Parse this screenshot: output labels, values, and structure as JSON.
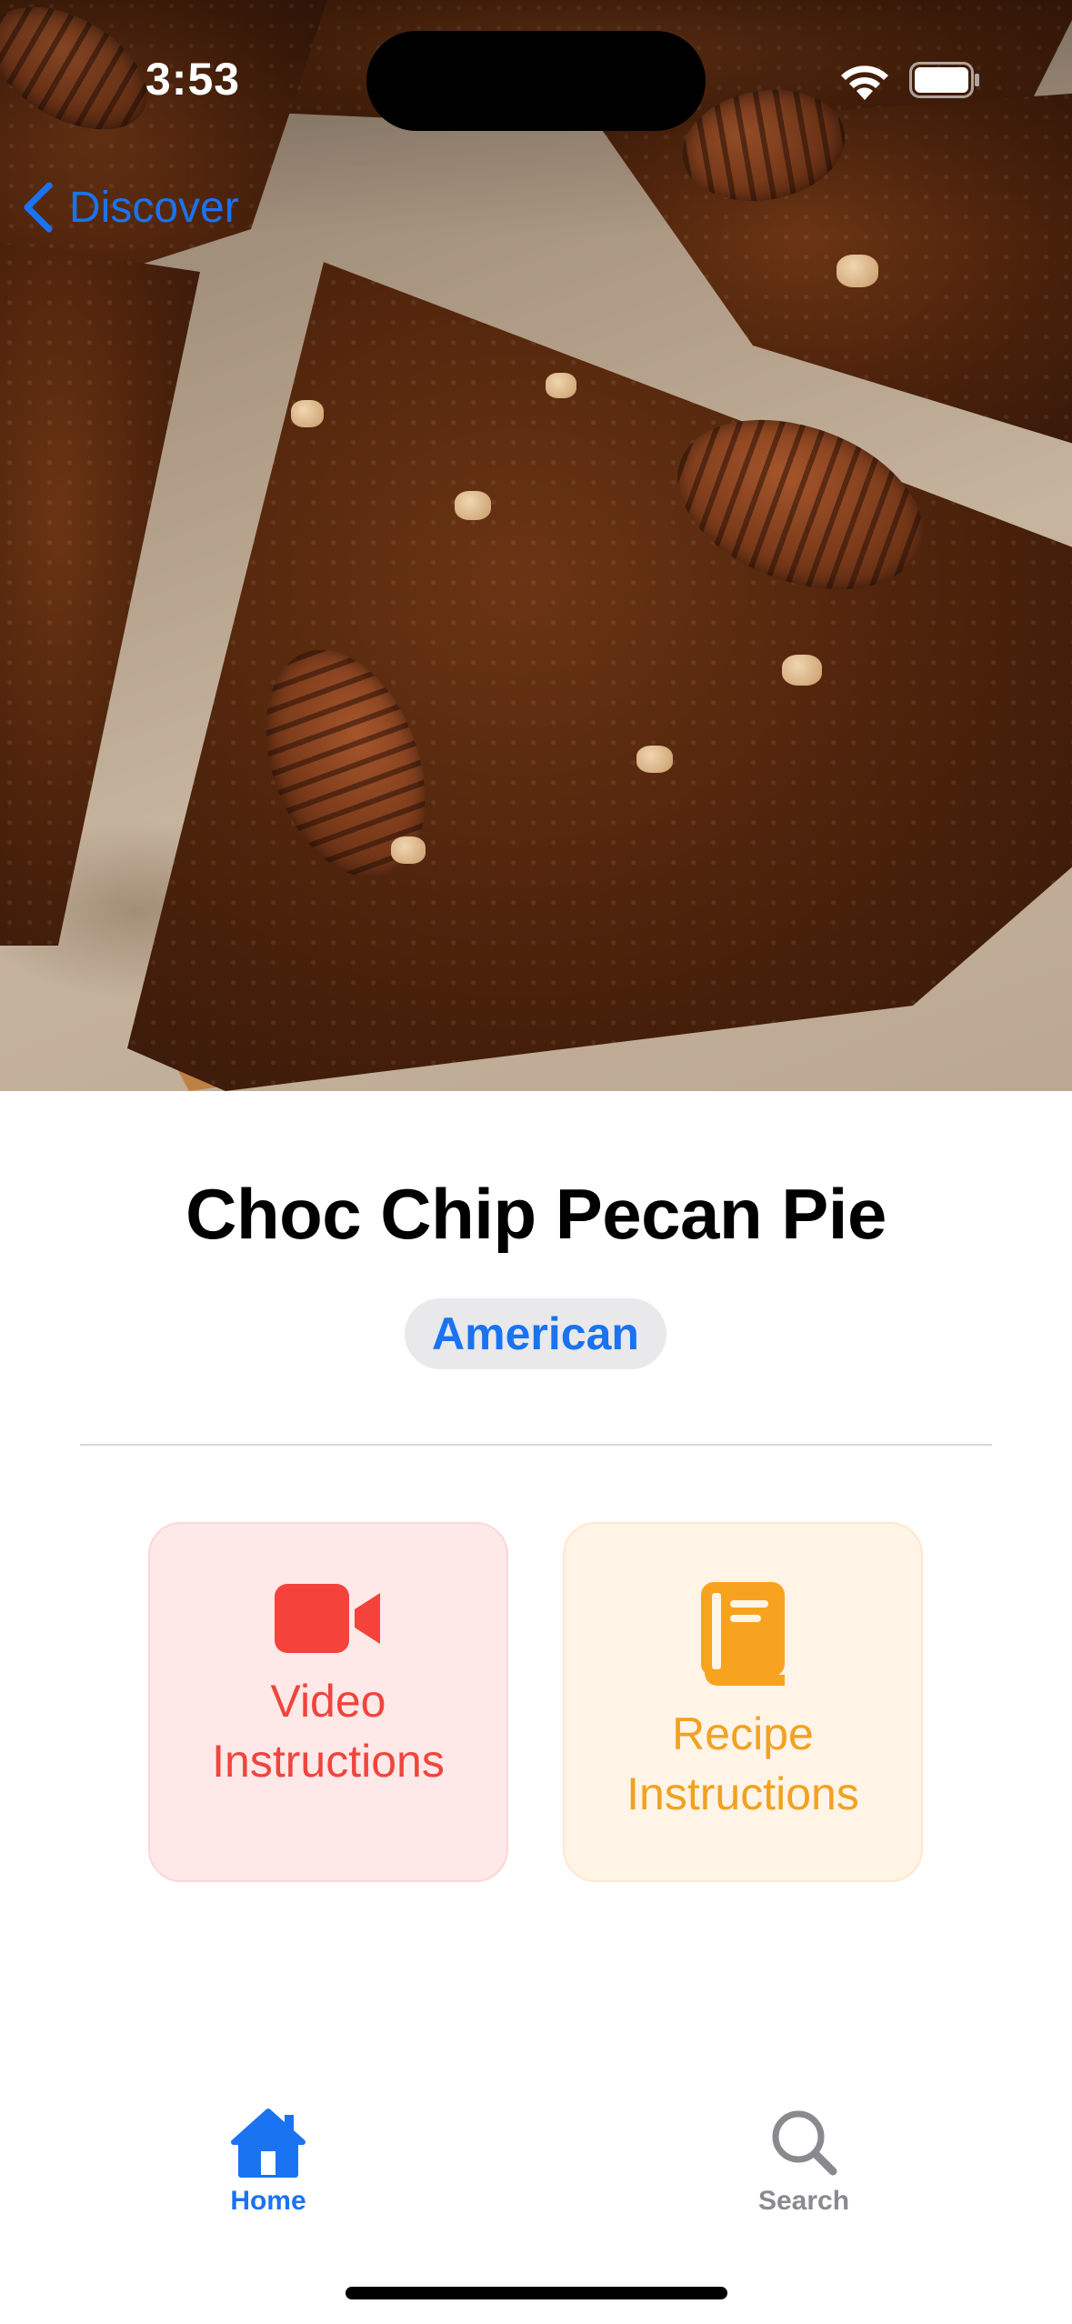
{
  "status_bar": {
    "time": "3:53"
  },
  "nav": {
    "back_label": "Discover"
  },
  "recipe": {
    "title": "Choc Chip Pecan Pie",
    "cuisine_tag": "American"
  },
  "actions": [
    {
      "label": "Video Instructions",
      "icon": "video-camera-icon",
      "color": "#f0443c",
      "background": "#ffe8e8"
    },
    {
      "label": "Recipe Instructions",
      "icon": "book-icon",
      "color": "#f2a120",
      "background": "#fff4e6"
    }
  ],
  "tab_bar": {
    "items": [
      {
        "label": "Home",
        "icon": "house-icon",
        "active": true
      },
      {
        "label": "Search",
        "icon": "magnifying-glass-icon",
        "active": false
      }
    ]
  },
  "colors": {
    "accent": "#1a73f0",
    "inactive": "#8a8a8e"
  }
}
